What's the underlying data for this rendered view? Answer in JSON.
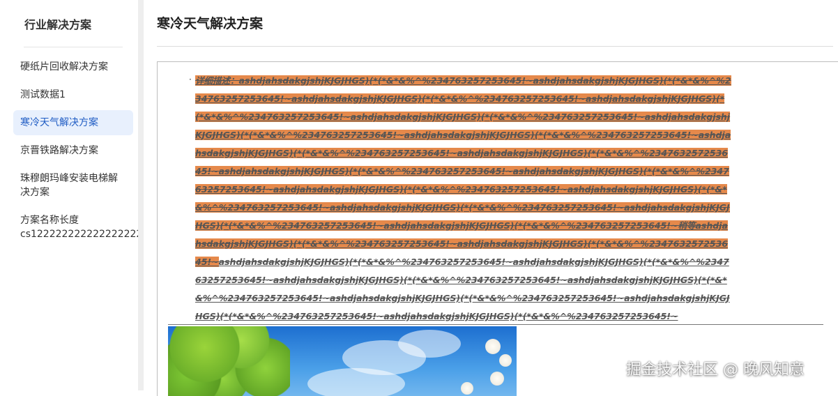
{
  "sidebar": {
    "title": "行业解决方案",
    "items": [
      {
        "label": "硬纸片回收解决方案",
        "active": false
      },
      {
        "label": "测试数据1",
        "active": false
      },
      {
        "label": "寒冷天气解决方案",
        "active": true
      },
      {
        "label": "京晋铁路解决方案",
        "active": false
      },
      {
        "label": "珠穆朗玛峰安装电梯解决方案",
        "active": false
      },
      {
        "label": "方案名称长度",
        "label_line2": "cs122222222222222222",
        "active": false
      }
    ]
  },
  "main": {
    "title": "寒冷天气解决方案",
    "bullet": "·",
    "description_highlighted": "详细描述：ashdjahsdakgjshjKJGJHGS)(*(*&*&%^%234763257253645!~ashdjahsdakgjshjKJGJHGS)(*(*&*&%^%234763257253645!~ashdjahsdakgjshjKJGJHGS)(*(*&*&%^%234763257253645!~ashdjahsdakgjshjKJGJHGS)(*(*&*&%^%234763257253645!~ashdjahsdakgjshjKJGJHGS)(*(*&*&%^%234763257253645!~ashdjahsdakgjshjKJGJHGS)(*(*&*&%^%234763257253645!~ashdjahsdakgjshjKJGJHGS)(*(*&*&%^%234763257253645!~ashdjahsdakgjshjKJGJHGS)(*(*&*&%^%234763257253645!~ashdjahsdakgjshjKJGJHGS)(*(*&*&%^%234763257253645!~ashdjahsdakgjshjKJGJHGS)(*(*&*&%^%234763257253645!~ashdjahsdakgjshjKJGJHGS)(*(*&*&%^%234763257253645!~ashdjahsdakgjshjKJGJHGS)(*(*&*&%^%234763257253645!~ashdjahsdakgjshjKJGJHGS)(*(*&*&%^%234763257253645!~ashdjahsdakgjshjKJGJHGS)(*(*&*&%^%234763257253645!~ashdjahsdakgjshjKJGJHGS)(*(*&*&%^%234763257253645!~ashdjahsdakgjshjKJGJHGS)(*(*&*&%^%234763257253645!~稍等ashdjahsdakgjshjKJGJHGS)(*(*&*&%^%234763257253645!~ashdjahsdakgjshjKJGJHGS)(*(*&*&%^%234763257253645!~",
    "description_plain": "ashdjahsdakgjshjKJGJHGS)(*(*&*&%^%234763257253645!~ashdjahsdakgjshjKJGJHGS)(*(*&*&%^%234763257253645!~ashdjahsdakgjshjKJGJHGS)(*(*&*&%^%234763257253645!~ashdjahsdakgjshjKJGJHGS)(*(*&*&%^%234763257253645!~ashdjahsdakgjshjKJGJHGS)(*(*&*&%^%234763257253645!~ashdjahsdakgjshjKJGJHGS)(*(*&*&%^%234763257253645!~ashdjahsdakgjshjKJGJHGS)(*(*&*&%^%234763257253645!~",
    "highlight_color": "#e5894b"
  },
  "watermark": "掘金技术社区 @ 晚风知意"
}
